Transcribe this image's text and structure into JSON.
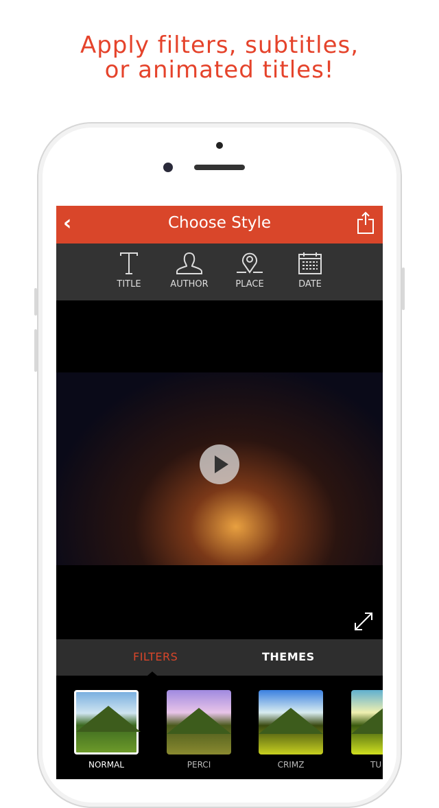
{
  "headline": [
    "Apply filters, subtitles,",
    "or animated titles!"
  ],
  "nav": {
    "title": "Choose Style",
    "back_icon": "chevron-left-icon",
    "share_icon": "share-icon"
  },
  "tools": [
    {
      "label": "TITLE",
      "icon": "text-icon"
    },
    {
      "label": "AUTHOR",
      "icon": "person-icon"
    },
    {
      "label": "PLACE",
      "icon": "location-pin-icon"
    },
    {
      "label": "DATE",
      "icon": "calendar-icon"
    }
  ],
  "tabs": {
    "filters": "FILTERS",
    "themes": "THEMES",
    "active": "FILTERS"
  },
  "filters": [
    {
      "label": "NORMAL",
      "selected": true
    },
    {
      "label": "PERCI"
    },
    {
      "label": "CRIMZ"
    },
    {
      "label": "TU"
    }
  ],
  "colors": {
    "accent": "#d9462a",
    "headline": "#e5432b",
    "toolbar": "#333333"
  }
}
